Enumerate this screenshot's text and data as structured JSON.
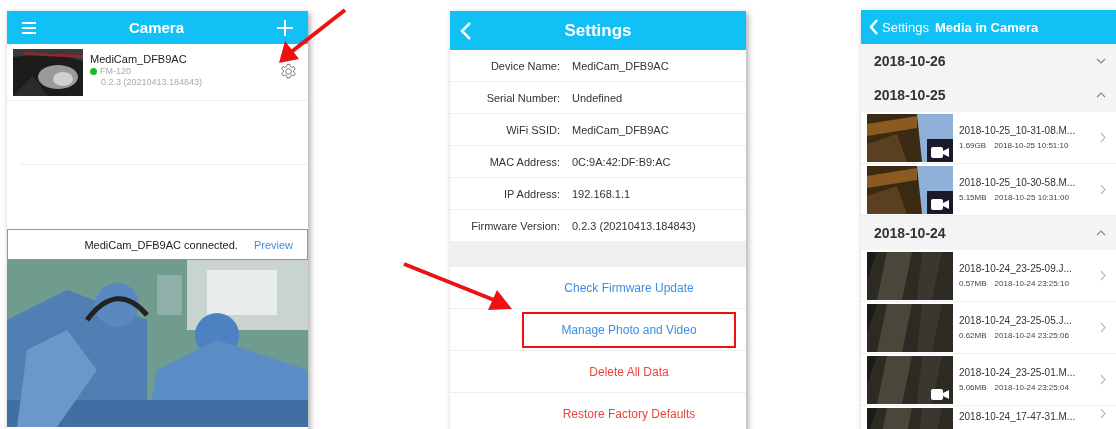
{
  "camera_screen": {
    "title": "Camera",
    "devices": [
      {
        "name": "MediCam_DFB9AC",
        "color": "#22b82a",
        "model": "FM-120",
        "firmware": "0.2.3 (20210413.184843)"
      }
    ],
    "connection_bar": {
      "message": "MediCam_DFB9AC connected.",
      "action": "Preview"
    }
  },
  "settings_screen": {
    "title": "Settings",
    "fields": [
      {
        "label": "Device Name:",
        "value": "MediCam_DFB9AC"
      },
      {
        "label": "Serial Number:",
        "value": "Undefined"
      },
      {
        "label": "WiFi SSID:",
        "value": "MediCam_DFB9AC"
      },
      {
        "label": "MAC Address:",
        "value": "0C:9A:42:DF:B9:AC"
      },
      {
        "label": "IP Address:",
        "value": "192.168.1.1"
      },
      {
        "label": "Firmware Version:",
        "value": "0.2.3 (20210413.184843)"
      }
    ],
    "actions": [
      {
        "label": "Check Firmware Update",
        "kind": "normal",
        "highlighted": false
      },
      {
        "label": "Manage Photo and Video",
        "kind": "normal",
        "highlighted": true
      },
      {
        "label": "Delete All Data",
        "kind": "destructive",
        "highlighted": false
      },
      {
        "label": "Restore Factory Defaults",
        "kind": "destructive",
        "highlighted": false
      }
    ]
  },
  "media_screen": {
    "back": "Settings",
    "title": "Media in Camera",
    "groups": [
      {
        "date": "2018-10-26",
        "expanded": false
      },
      {
        "date": "2018-10-25",
        "expanded": true,
        "items": [
          {
            "name": "2018-10-25_10-31-08.M...",
            "size": "1.69GB",
            "time": "2018-10-25 10:51:10",
            "kind": "video"
          },
          {
            "name": "2018-10-25_10-30-58.M...",
            "size": "5.15MB",
            "time": "2018-10-25 10:31:00",
            "kind": "video"
          }
        ]
      },
      {
        "date": "2018-10-24",
        "expanded": true,
        "items": [
          {
            "name": "2018-10-24_23-25-09.J...",
            "size": "0.57MB",
            "time": "2018-10-24 23:25:10"
          },
          {
            "name": "2018-10-24_23-25-05.J...",
            "size": "0.62MB",
            "time": "2018-10-24 23:25:06"
          },
          {
            "name": "2018-10-24_23-25-01.M...",
            "size": "5.06MB",
            "time": "2018-10-24 23:25:04",
            "kind": "video"
          },
          {
            "name": "2018-10-24_17-47-31.M..."
          }
        ]
      }
    ]
  }
}
